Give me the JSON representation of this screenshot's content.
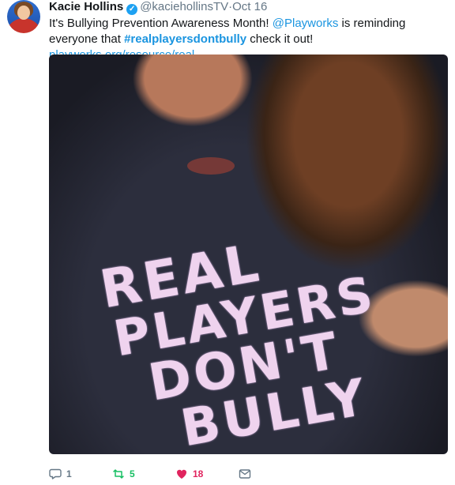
{
  "tweet": {
    "author_name": "Kacie Hollins",
    "handle": "@kaciehollinsTV",
    "separator": "·",
    "timestamp": "Oct 16",
    "text_part1": "It's Bullying Prevention Awareness Month! ",
    "mention": "@Playworks",
    "text_part2": " is reminding everyone that ",
    "hashtag": "#realplayersdontbully",
    "text_part3": " check it out! ",
    "link": "playworks.org/resource/real-…",
    "image_text": {
      "line1": "REAL",
      "line2": "PLAYERS",
      "line3": "DON'T",
      "line4": "BULLY"
    },
    "reply_count": "1",
    "retweet_count": "5",
    "like_count": "18"
  },
  "icons": {
    "verified": "verified-badge-icon",
    "reply": "comment-bubble-icon",
    "retweet": "retweet-arrows-icon",
    "like": "heart-icon",
    "dm": "envelope-icon"
  },
  "colors": {
    "link": "#1b95e0",
    "retweet": "#17bf63",
    "like": "#e0245e",
    "muted": "#657786",
    "verified": "#1da1f2"
  }
}
